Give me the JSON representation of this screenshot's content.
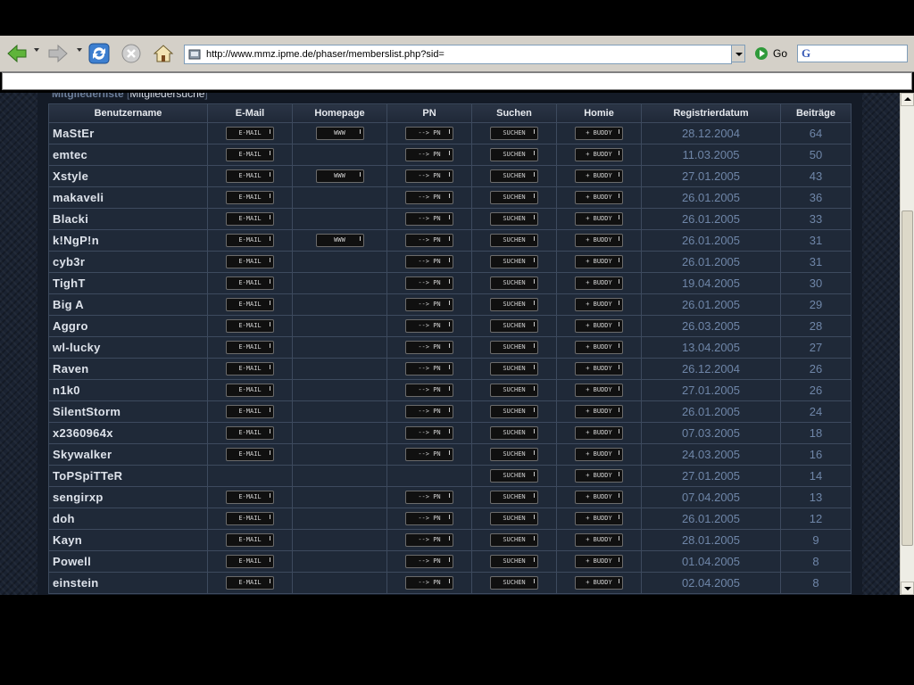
{
  "browser": {
    "url": "http://www.mmz.ipme.de/phaser/memberslist.php?sid=",
    "go_label": "Go",
    "search_engine_glyph": "G"
  },
  "page": {
    "heading": "Mitgliederliste",
    "heading_sub": "Mitgliedersuche",
    "columns": [
      "Benutzername",
      "E-Mail",
      "Homepage",
      "PN",
      "Suchen",
      "Homie",
      "Registrierdatum",
      "Beiträge"
    ],
    "button_labels": {
      "email": "E-MAIL",
      "www": "WWW",
      "pn": "--> PN",
      "search": "SUCHEN",
      "buddy": "+ BUDDY"
    },
    "members": [
      {
        "name": "MaStEr",
        "email": true,
        "www": true,
        "pn": true,
        "date": "28.12.2004",
        "posts": "64"
      },
      {
        "name": "emtec",
        "email": true,
        "www": false,
        "pn": true,
        "date": "11.03.2005",
        "posts": "50"
      },
      {
        "name": "Xstyle",
        "email": true,
        "www": true,
        "pn": true,
        "date": "27.01.2005",
        "posts": "43"
      },
      {
        "name": "makaveli",
        "email": true,
        "www": false,
        "pn": true,
        "date": "26.01.2005",
        "posts": "36"
      },
      {
        "name": "Blacki",
        "email": true,
        "www": false,
        "pn": true,
        "date": "26.01.2005",
        "posts": "33"
      },
      {
        "name": "k!NgP!n",
        "email": true,
        "www": true,
        "pn": true,
        "date": "26.01.2005",
        "posts": "31"
      },
      {
        "name": "cyb3r",
        "email": true,
        "www": false,
        "pn": true,
        "date": "26.01.2005",
        "posts": "31"
      },
      {
        "name": "TighT",
        "email": true,
        "www": false,
        "pn": true,
        "date": "19.04.2005",
        "posts": "30"
      },
      {
        "name": "Big A",
        "email": true,
        "www": false,
        "pn": true,
        "date": "26.01.2005",
        "posts": "29"
      },
      {
        "name": "Aggro",
        "email": true,
        "www": false,
        "pn": true,
        "date": "26.03.2005",
        "posts": "28"
      },
      {
        "name": "wl-lucky",
        "email": true,
        "www": false,
        "pn": true,
        "date": "13.04.2005",
        "posts": "27"
      },
      {
        "name": "Raven",
        "email": true,
        "www": false,
        "pn": true,
        "date": "26.12.2004",
        "posts": "26"
      },
      {
        "name": "n1k0",
        "email": true,
        "www": false,
        "pn": true,
        "date": "27.01.2005",
        "posts": "26"
      },
      {
        "name": "SilentStorm",
        "email": true,
        "www": false,
        "pn": true,
        "date": "26.01.2005",
        "posts": "24"
      },
      {
        "name": "x2360964x",
        "email": true,
        "www": false,
        "pn": true,
        "date": "07.03.2005",
        "posts": "18"
      },
      {
        "name": "Skywalker",
        "email": true,
        "www": false,
        "pn": true,
        "date": "24.03.2005",
        "posts": "16"
      },
      {
        "name": "ToPSpiTTeR",
        "email": false,
        "www": false,
        "pn": false,
        "date": "27.01.2005",
        "posts": "14"
      },
      {
        "name": "sengirxp",
        "email": true,
        "www": false,
        "pn": true,
        "date": "07.04.2005",
        "posts": "13"
      },
      {
        "name": "doh",
        "email": true,
        "www": false,
        "pn": true,
        "date": "26.01.2005",
        "posts": "12"
      },
      {
        "name": "Kayn",
        "email": true,
        "www": false,
        "pn": true,
        "date": "28.01.2005",
        "posts": "9"
      },
      {
        "name": "Powell",
        "email": true,
        "www": false,
        "pn": true,
        "date": "01.04.2005",
        "posts": "8"
      },
      {
        "name": "einstein",
        "email": true,
        "www": false,
        "pn": true,
        "date": "02.04.2005",
        "posts": "8"
      }
    ]
  }
}
